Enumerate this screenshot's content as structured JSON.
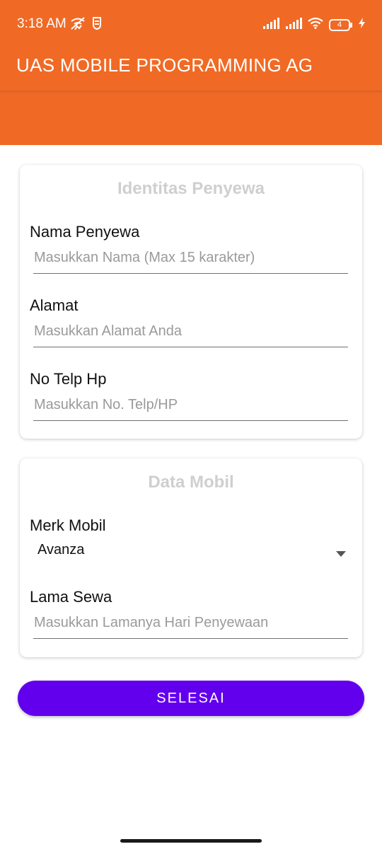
{
  "status_bar": {
    "time": "3:18 AM",
    "battery_level": "4",
    "icons": [
      "wifi-calling-off-icon",
      "shield-icon",
      "signal-icon",
      "signal-icon",
      "wifi-icon",
      "battery-icon",
      "charging-icon"
    ]
  },
  "app_bar": {
    "title": "UAS MOBILE PROGRAMMING AG"
  },
  "renter_card": {
    "title": "Identitas Penyewa",
    "name": {
      "label": "Nama Penyewa",
      "value": "",
      "placeholder": "Masukkan Nama (Max 15 karakter)"
    },
    "address": {
      "label": "Alamat",
      "value": "",
      "placeholder": "Masukkan Alamat Anda"
    },
    "phone": {
      "label": "No Telp Hp",
      "value": "",
      "placeholder": "Masukkan No. Telp/HP"
    }
  },
  "car_card": {
    "title": "Data Mobil",
    "brand": {
      "label": "Merk Mobil",
      "selected": "Avanza"
    },
    "duration": {
      "label": "Lama Sewa",
      "value": "",
      "placeholder": "Masukkan Lamanya Hari Penyewaan"
    }
  },
  "submit_label": "SELESAI",
  "colors": {
    "header": "#f06a25",
    "button": "#6200ee",
    "card_title": "#cfcfcf"
  }
}
